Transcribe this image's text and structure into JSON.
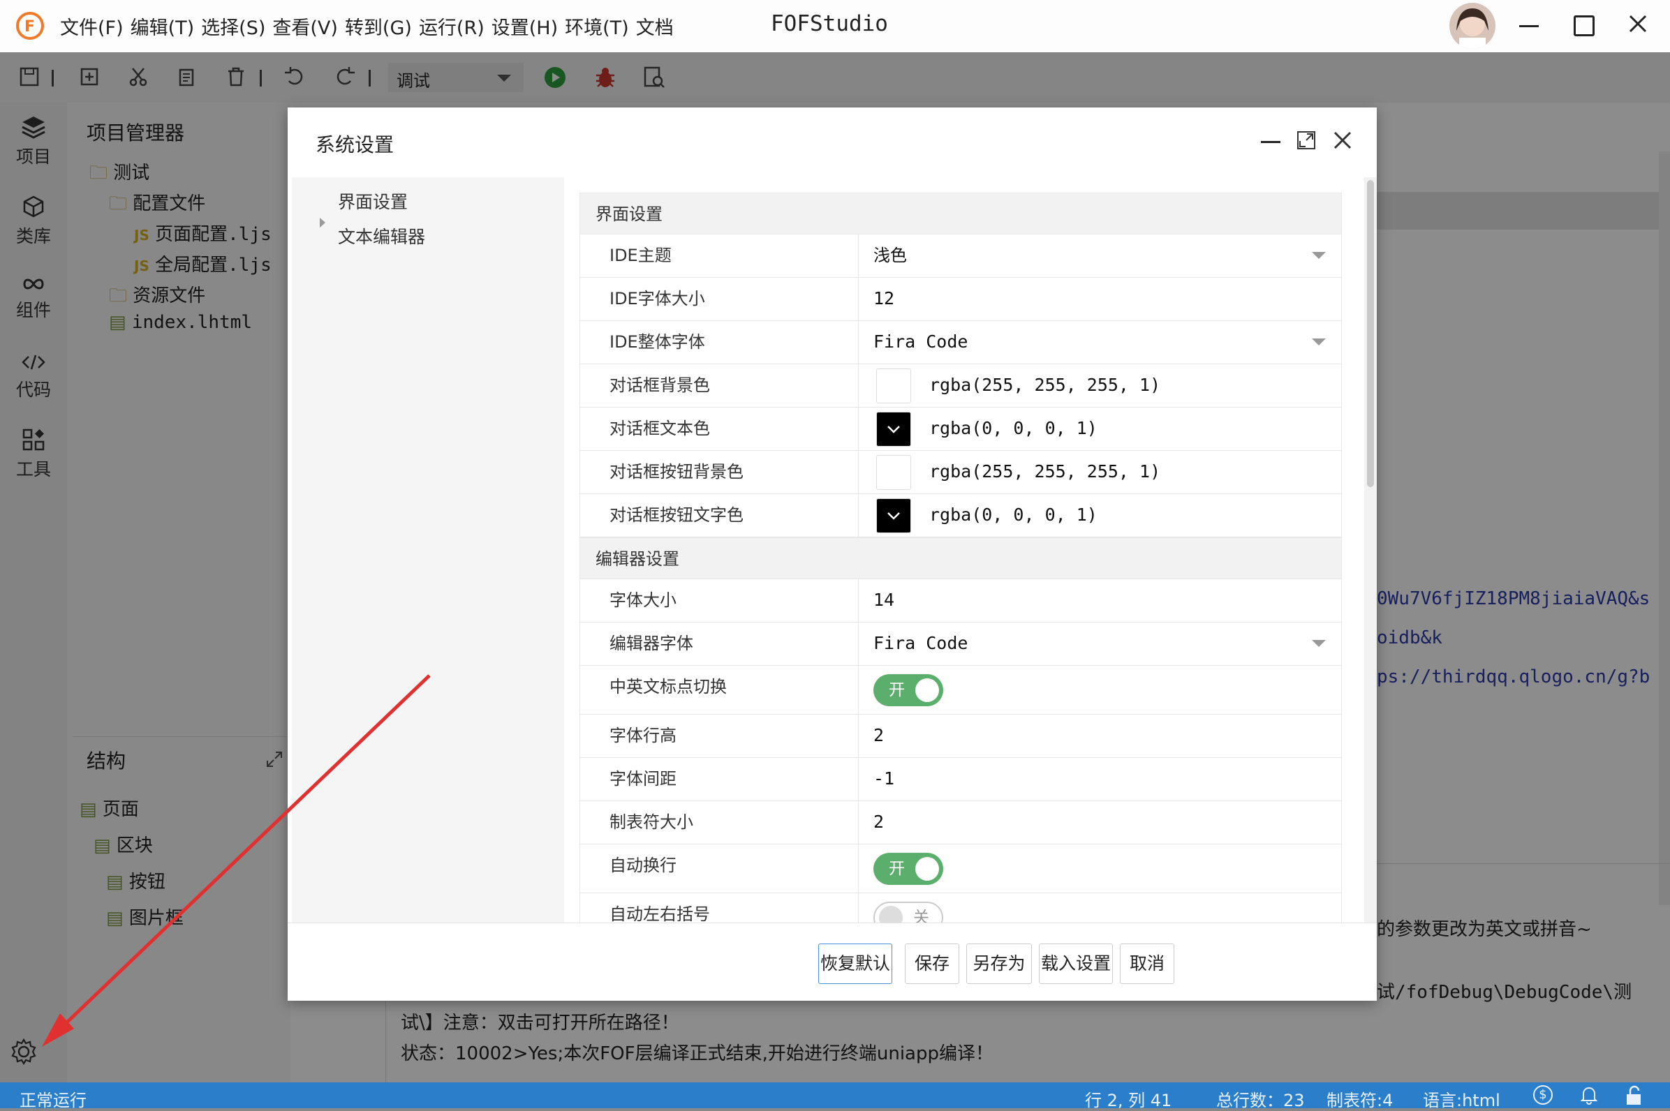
{
  "titlebar": {
    "menus": [
      "文件(F)",
      "编辑(T)",
      "选择(S)",
      "查看(V)",
      "转到(G)",
      "运行(R)",
      "设置(H)",
      "环境(T)",
      "文档"
    ],
    "app_title": "FOFStudio"
  },
  "toolbar": {
    "run_mode": "调试"
  },
  "activity_bar": {
    "items": [
      "项目",
      "类库",
      "组件",
      "代码",
      "工具"
    ]
  },
  "project_panel": {
    "title": "项目管理器",
    "tree": [
      {
        "label": "测试",
        "type": "folder"
      },
      {
        "label": "配置文件",
        "type": "folder"
      },
      {
        "label": "页面配置.ljs",
        "type": "js"
      },
      {
        "label": "全局配置.ljs",
        "type": "js"
      },
      {
        "label": "资源文件",
        "type": "folder"
      },
      {
        "label": "index.lhtml",
        "type": "html"
      }
    ]
  },
  "structure_panel": {
    "title": "结构",
    "tree": [
      "页面",
      "区块",
      "按钮",
      "图片框"
    ]
  },
  "editor": {
    "lines": [
      "0Wu7V6fjIZ18PM8jiaiaVAQ&s",
      "oidb&k",
      "ps://thirdqq.qlogo.cn/g?b"
    ],
    "output_lines": [
      "的参数更改为英文或拼音~",
      "试/fofDebug\\DebugCode\\测",
      "试\\】注意：双击可打开所在路径！",
      "状态：10002>Yes;本次FOF层编译正式结束,开始进行终端uniapp编译！"
    ]
  },
  "statusbar": {
    "left": "正常运行",
    "position": "行 2, 列 41",
    "total_lines": "总行数：23",
    "tab_size": "制表符:4",
    "language": "语言:html"
  },
  "dialog": {
    "title": "系统设置",
    "nav": [
      "界面设置",
      "文本编辑器"
    ],
    "sections": [
      {
        "title": "界面设置",
        "rows": [
          {
            "label": "IDE主题",
            "value": "浅色",
            "kind": "select"
          },
          {
            "label": "IDE字体大小",
            "value": "12",
            "kind": "text"
          },
          {
            "label": "IDE整体字体",
            "value": "Fira Code",
            "kind": "select"
          },
          {
            "label": "对话框背景色",
            "value": "rgba(255, 255, 255, 1)",
            "kind": "color",
            "swatch": "#ffffff"
          },
          {
            "label": "对话框文本色",
            "value": "rgba(0, 0, 0, 1)",
            "kind": "color",
            "swatch": "#000000"
          },
          {
            "label": "对话框按钮背景色",
            "value": "rgba(255, 255, 255, 1)",
            "kind": "color",
            "swatch": "#ffffff"
          },
          {
            "label": "对话框按钮文字色",
            "value": "rgba(0, 0, 0, 1)",
            "kind": "color",
            "swatch": "#000000"
          }
        ]
      },
      {
        "title": "编辑器设置",
        "rows": [
          {
            "label": "字体大小",
            "value": "14",
            "kind": "text"
          },
          {
            "label": "编辑器字体",
            "value": "Fira Code",
            "kind": "select"
          },
          {
            "label": "中英文标点切换",
            "value": "开",
            "kind": "toggle-on"
          },
          {
            "label": "字体行高",
            "value": "2",
            "kind": "text"
          },
          {
            "label": "字体间距",
            "value": "-1",
            "kind": "text"
          },
          {
            "label": "制表符大小",
            "value": "2",
            "kind": "text"
          },
          {
            "label": "自动换行",
            "value": "开",
            "kind": "toggle-on"
          },
          {
            "label": "自动左右括号",
            "value": "关",
            "kind": "toggle-off"
          }
        ]
      }
    ],
    "buttons": [
      "恢复默认",
      "保存",
      "另存为",
      "载入设置",
      "取消"
    ]
  },
  "colors": {
    "accent_blue": "#2b7ec9",
    "toggle_on": "#5cae6c",
    "annotation_arrow": "#e03030"
  }
}
